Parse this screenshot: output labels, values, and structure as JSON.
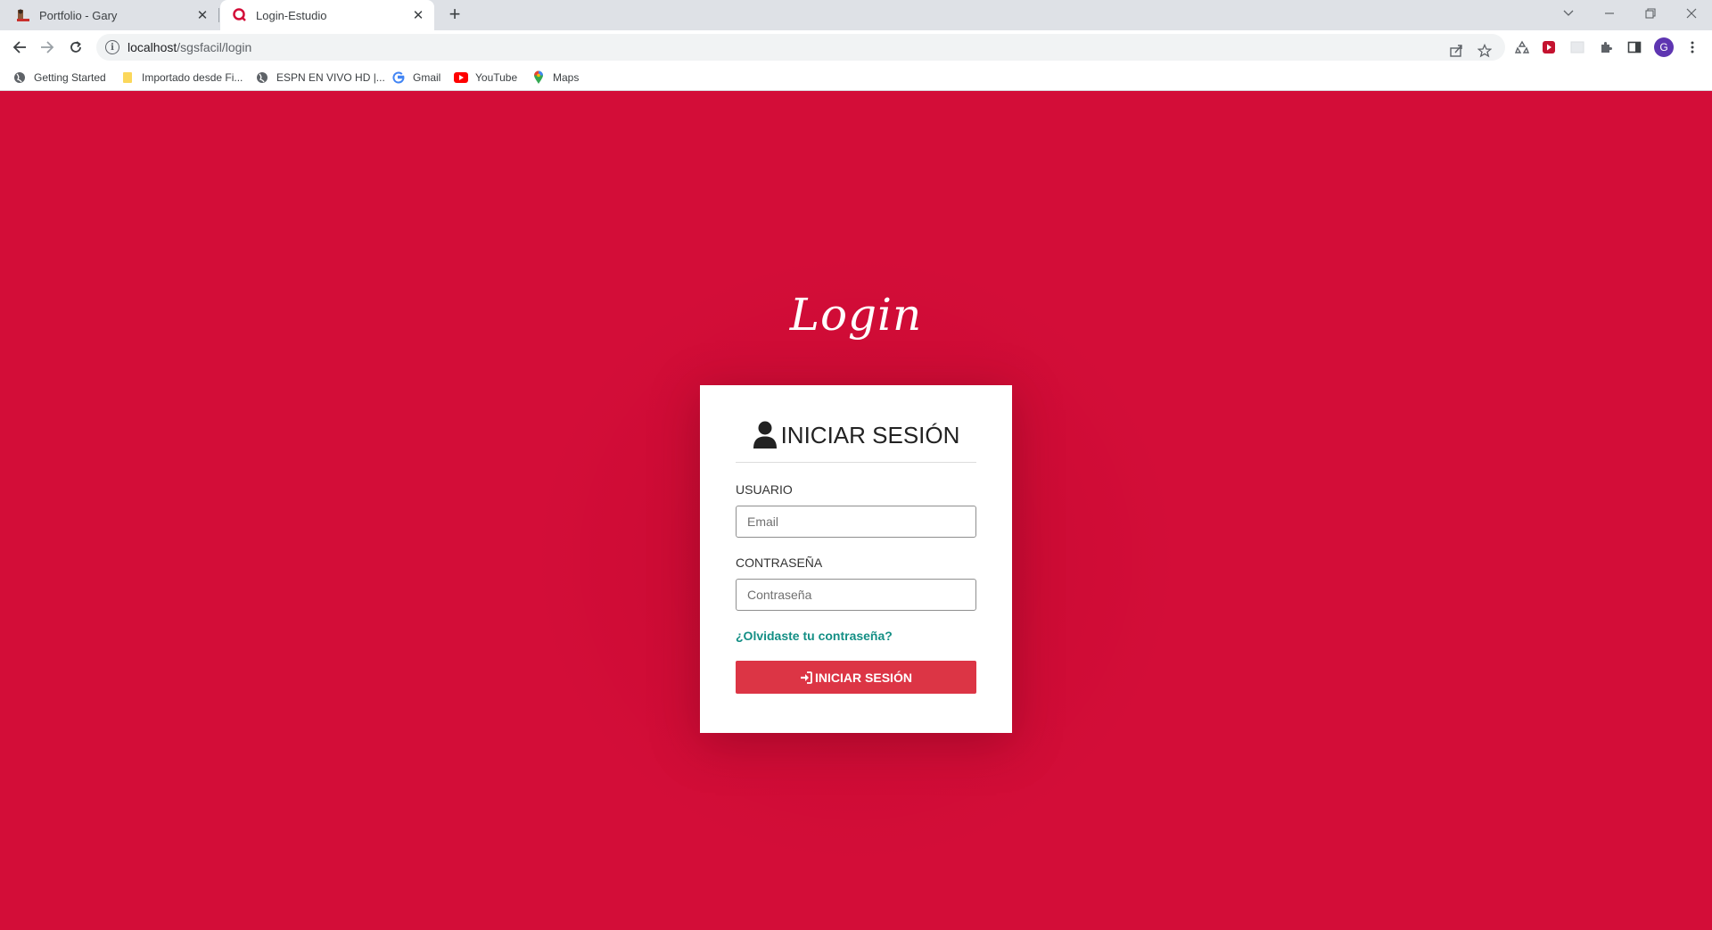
{
  "browser": {
    "tabs": [
      {
        "title": "Portfolio - Gary",
        "active": false
      },
      {
        "title": "Login-Estudio",
        "active": true
      }
    ],
    "url_host": "localhost",
    "url_path": "/sgsfacil/login",
    "profile_initial": "G",
    "bookmarks": [
      {
        "label": "Getting Started",
        "icon": "globe-icon"
      },
      {
        "label": "Importado desde Fi...",
        "icon": "folder-icon"
      },
      {
        "label": "ESPN EN VIVO HD |...",
        "icon": "globe-icon"
      },
      {
        "label": "Gmail",
        "icon": "google-icon"
      },
      {
        "label": "YouTube",
        "icon": "youtube-icon"
      },
      {
        "label": "Maps",
        "icon": "maps-icon"
      }
    ]
  },
  "page": {
    "heading": "Login",
    "card_title": "INICIAR SESIÓN",
    "username_label": "USUARIO",
    "username_placeholder": "Email",
    "password_label": "CONTRASEÑA",
    "password_placeholder": "Contraseña",
    "forgot_link": "¿Olvidaste tu contraseña?",
    "submit_label": "INICIAR SESIÓN"
  },
  "colors": {
    "background": "#d30d38",
    "button": "#dc3545",
    "link": "#148f85"
  }
}
